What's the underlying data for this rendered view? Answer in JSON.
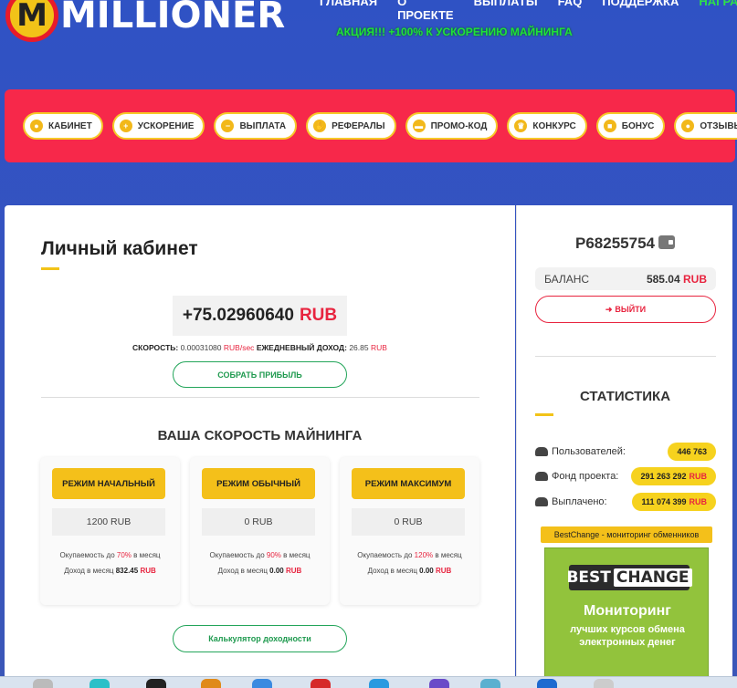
{
  "header": {
    "logo_letter": "M",
    "logo_text": "MILLIONER",
    "nav": [
      "ГЛАВНАЯ",
      "О ПРОЕКТЕ",
      "ВЫПЛАТЫ",
      "FAQ",
      "ПОДДЕРЖКА",
      "НАГРАДА"
    ],
    "promo": "АКЦИЯ!!! +100% К УСКОРЕНИЮ МАЙНИНГА"
  },
  "menu": [
    {
      "label": "КАБИНЕТ",
      "icon": "user-icon"
    },
    {
      "label": "УСКОРЕНИЕ",
      "icon": "plus-icon"
    },
    {
      "label": "ВЫПЛАТА",
      "icon": "minus-icon"
    },
    {
      "label": "РЕФЕРАЛЫ",
      "icon": "handshake-icon"
    },
    {
      "label": "ПРОМО-КОД",
      "icon": "ticket-icon"
    },
    {
      "label": "КОНКУРС",
      "icon": "trophy-icon"
    },
    {
      "label": "БОНУС",
      "icon": "gift-icon"
    },
    {
      "label": "ОТЗЫВЫ",
      "icon": "comments-icon"
    }
  ],
  "cabinet": {
    "title": "Личный кабинет",
    "amount": "+75.02960640",
    "amount_currency": "RUB",
    "speed_label": "СКОРОСТЬ:",
    "speed_value": "0.00031080",
    "speed_unit": "RUB/sec",
    "daily_label": "ЕЖЕДНЕВНЫЙ ДОХОД:",
    "daily_value": "26.85",
    "daily_unit": "RUB",
    "collect_button": "СОБРАТЬ ПРИБЫЛЬ",
    "section_title": "ВАША СКОРОСТЬ МАЙНИНГА",
    "roi_prefix": "Окупаемость до",
    "roi_suffix": "в месяц",
    "income_prefix": "Доход в месяц",
    "income_unit": "RUB",
    "modes": [
      {
        "button": "РЕЖИМ НАЧАЛЬНЫЙ",
        "price": "1200 RUB",
        "roi": "70%",
        "income": "832.45"
      },
      {
        "button": "РЕЖИМ ОБЫЧНЫЙ",
        "price": "0 RUB",
        "roi": "90%",
        "income": "0.00"
      },
      {
        "button": "РЕЖИМ МАКСИМУМ",
        "price": "0 RUB",
        "roi": "120%",
        "income": "0.00"
      }
    ],
    "calc_button": "Калькулятор доходности"
  },
  "sidebar": {
    "account_id": "P68255754",
    "balance_label": "БАЛАНС",
    "balance_value": "585.04",
    "balance_currency": "RUB",
    "logout_button": "ВЫЙТИ",
    "logout_icon": "sign-out-icon",
    "stats_title": "СТАТИСТИКА",
    "stats": [
      {
        "label": "Пользователей:",
        "value": "446 763",
        "currency": "",
        "icon": "users-icon"
      },
      {
        "label": "Фонд проекта:",
        "value": "291 263 292",
        "currency": "RUB",
        "icon": "cloud-icon"
      },
      {
        "label": "Выплачено:",
        "value": "111 074 399",
        "currency": "RUB",
        "icon": "cloud-download-icon"
      }
    ],
    "bestchange_label": "BestChange - мониторинг обменников",
    "bestchange_logo_a": "BEST",
    "bestchange_logo_b": "CHANGE",
    "bestchange_line1": "Мониторинг",
    "bestchange_line2": "лучших курсов обмена электронных денег"
  },
  "colors": {
    "accent_red": "#e8243f",
    "accent_yellow": "#f4c01a",
    "accent_green": "#23a55a",
    "background_blue": "#3553c0"
  }
}
